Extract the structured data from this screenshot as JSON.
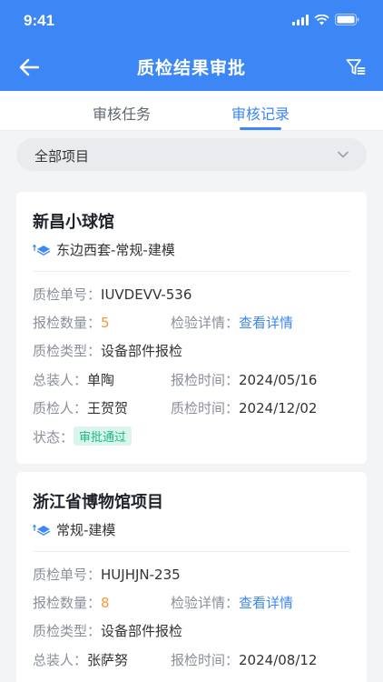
{
  "status_bar": {
    "time": "9:41"
  },
  "nav": {
    "title": "质检结果审批"
  },
  "tabs": [
    {
      "label": "审核任务",
      "active": false
    },
    {
      "label": "审核记录",
      "active": true
    }
  ],
  "project_select": {
    "value": "全部项目"
  },
  "labels": {
    "inspection_no": "质检单号：",
    "report_qty": "报检数量：",
    "detail": "检验详情：",
    "type": "质检类型：",
    "assembler": "总装人：",
    "report_time": "报检时间：",
    "inspector": "质检人：",
    "inspect_time": "质检时间：",
    "status": "状态："
  },
  "records": [
    {
      "title": "新昌小球馆",
      "subtitle": "东边西套-常规-建模",
      "inspection_no": "IUVDEVV-536",
      "report_qty": "5",
      "detail_link": "查看详情",
      "type": "设备部件报检",
      "assembler": "单陶",
      "report_time": "2024/05/16",
      "inspector": "王贺贺",
      "inspect_time": "2024/12/02",
      "status": "审批通过"
    },
    {
      "title": "浙江省博物馆项目",
      "subtitle": "常规-建模",
      "inspection_no": "HUJHJN-235",
      "report_qty": "8",
      "detail_link": "查看详情",
      "type": "设备部件报检",
      "assembler": "张萨努",
      "report_time": "2024/08/12"
    }
  ],
  "colors": {
    "primary": "#3d86f5",
    "qty": "#f29a3a",
    "status_bg": "#d9f5ec",
    "status_text": "#1fb786"
  }
}
